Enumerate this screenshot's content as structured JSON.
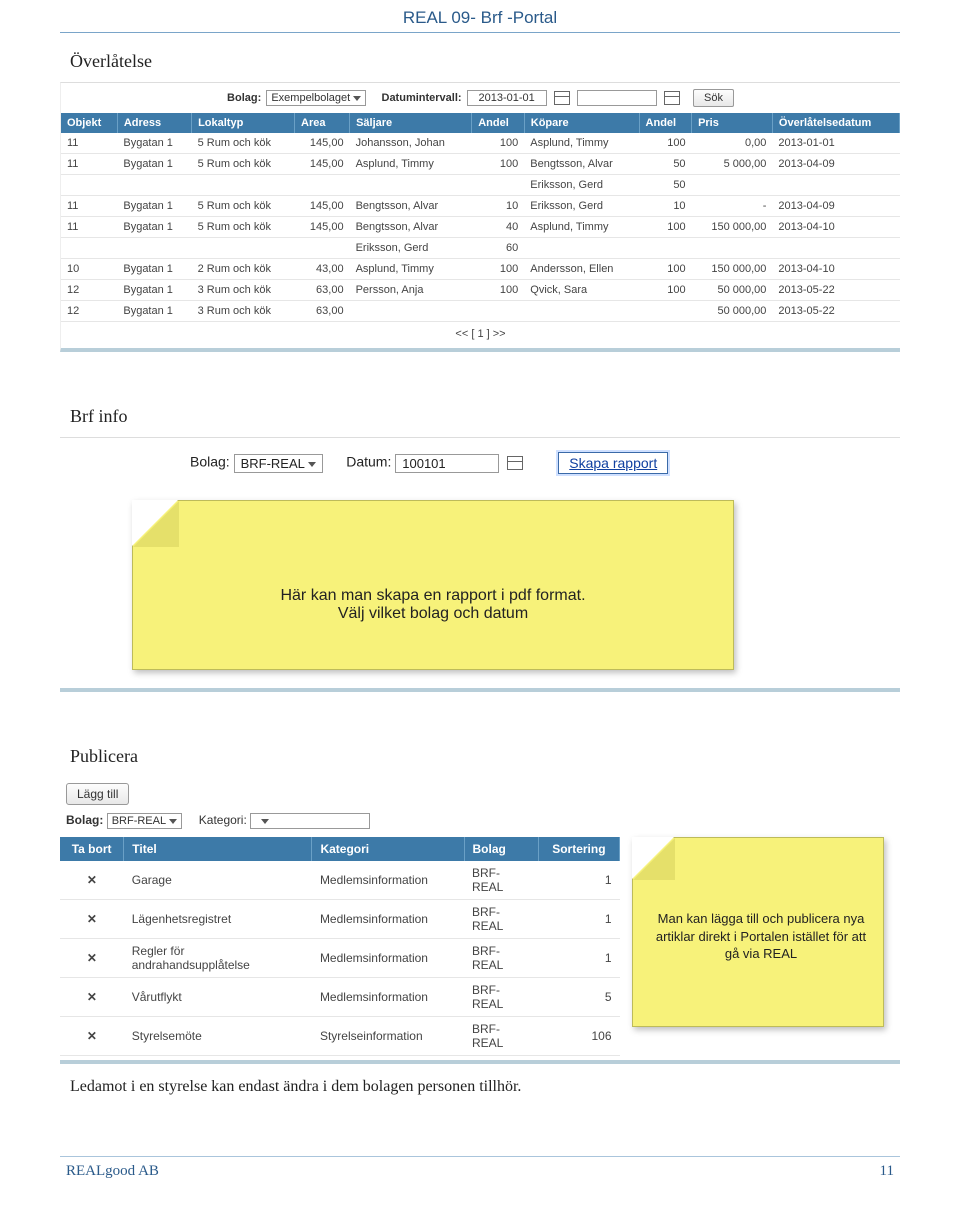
{
  "header": {
    "title": "REAL 09- Brf -Portal"
  },
  "s1": {
    "title": "Överlåtelse",
    "filter": {
      "bolag_label": "Bolag:",
      "bolag_value": "Exempelbolaget",
      "date_label": "Datumintervall:",
      "date_from": "2013-01-01",
      "sok": "Sök"
    },
    "cols": [
      "Objekt",
      "Adress",
      "Lokaltyp",
      "Area",
      "Säljare",
      "Andel",
      "Köpare",
      "Andel",
      "Pris",
      "Överlåtelsedatum"
    ],
    "rows": [
      [
        "11",
        "Bygatan 1",
        "5 Rum och kök",
        "145,00",
        "Johansson, Johan",
        "100",
        "Asplund, Timmy",
        "100",
        "0,00",
        "2013-01-01"
      ],
      [
        "11",
        "Bygatan 1",
        "5 Rum och kök",
        "145,00",
        "Asplund, Timmy",
        "100",
        "Bengtsson, Alvar",
        "50",
        "5 000,00",
        "2013-04-09"
      ],
      [
        "",
        "",
        "",
        "",
        "",
        "",
        "Eriksson, Gerd",
        "50",
        "",
        ""
      ],
      [
        "11",
        "Bygatan 1",
        "5 Rum och kök",
        "145,00",
        "Bengtsson, Alvar",
        "10",
        "Eriksson, Gerd",
        "10",
        "-",
        "2013-04-09"
      ],
      [
        "11",
        "Bygatan 1",
        "5 Rum och kök",
        "145,00",
        "Bengtsson, Alvar",
        "40",
        "Asplund, Timmy",
        "100",
        "150 000,00",
        "2013-04-10"
      ],
      [
        "",
        "",
        "",
        "",
        "Eriksson, Gerd",
        "60",
        "",
        "",
        "",
        ""
      ],
      [
        "10",
        "Bygatan 1",
        "2 Rum och kök",
        "43,00",
        "Asplund, Timmy",
        "100",
        "Andersson, Ellen",
        "100",
        "150 000,00",
        "2013-04-10"
      ],
      [
        "12",
        "Bygatan 1",
        "3 Rum och kök",
        "63,00",
        "Persson, Anja",
        "100",
        "Qvick, Sara",
        "100",
        "50 000,00",
        "2013-05-22"
      ],
      [
        "12",
        "Bygatan 1",
        "3 Rum och kök",
        "63,00",
        "",
        "",
        "",
        "",
        "50 000,00",
        "2013-05-22"
      ]
    ],
    "pager": "<<  [ 1 ]  >>"
  },
  "s2": {
    "title": "Brf info",
    "filter": {
      "bolag_label": "Bolag:",
      "bolag_value": "BRF-REAL",
      "date_label": "Datum:",
      "date_value": "100101",
      "btn": "Skapa rapport"
    },
    "note_line1": "Här kan man skapa en rapport i pdf format.",
    "note_line2": "Välj vilket bolag och datum"
  },
  "s3": {
    "title": "Publicera",
    "lagg": "Lägg till",
    "filter": {
      "bolag_label": "Bolag:",
      "bolag_value": "BRF-REAL",
      "kat_label": "Kategori:"
    },
    "cols": [
      "Ta bort",
      "Titel",
      "Kategori",
      "Bolag",
      "Sortering"
    ],
    "rows": [
      {
        "titel": "Garage",
        "kategori": "Medlemsinformation",
        "bolag": "BRF-REAL",
        "sort": "1"
      },
      {
        "titel": "Lägenhetsregistret",
        "kategori": "Medlemsinformation",
        "bolag": "BRF-REAL",
        "sort": "1"
      },
      {
        "titel": "Regler för andrahandsupplåtelse",
        "kategori": "Medlemsinformation",
        "bolag": "BRF-REAL",
        "sort": "1"
      },
      {
        "titel": "Vårutflykt",
        "kategori": "Medlemsinformation",
        "bolag": "BRF-REAL",
        "sort": "5"
      },
      {
        "titel": "Styrelsemöte",
        "kategori": "Styrelseinformation",
        "bolag": "BRF-REAL",
        "sort": "106"
      }
    ],
    "note": "Man kan lägga till och publicera nya artiklar direkt i Portalen istället för att gå via REAL"
  },
  "body_text": "Ledamot i en styrelse kan endast ändra i dem bolagen personen tillhör.",
  "footer": {
    "left": "REALgood AB",
    "right": "11"
  }
}
